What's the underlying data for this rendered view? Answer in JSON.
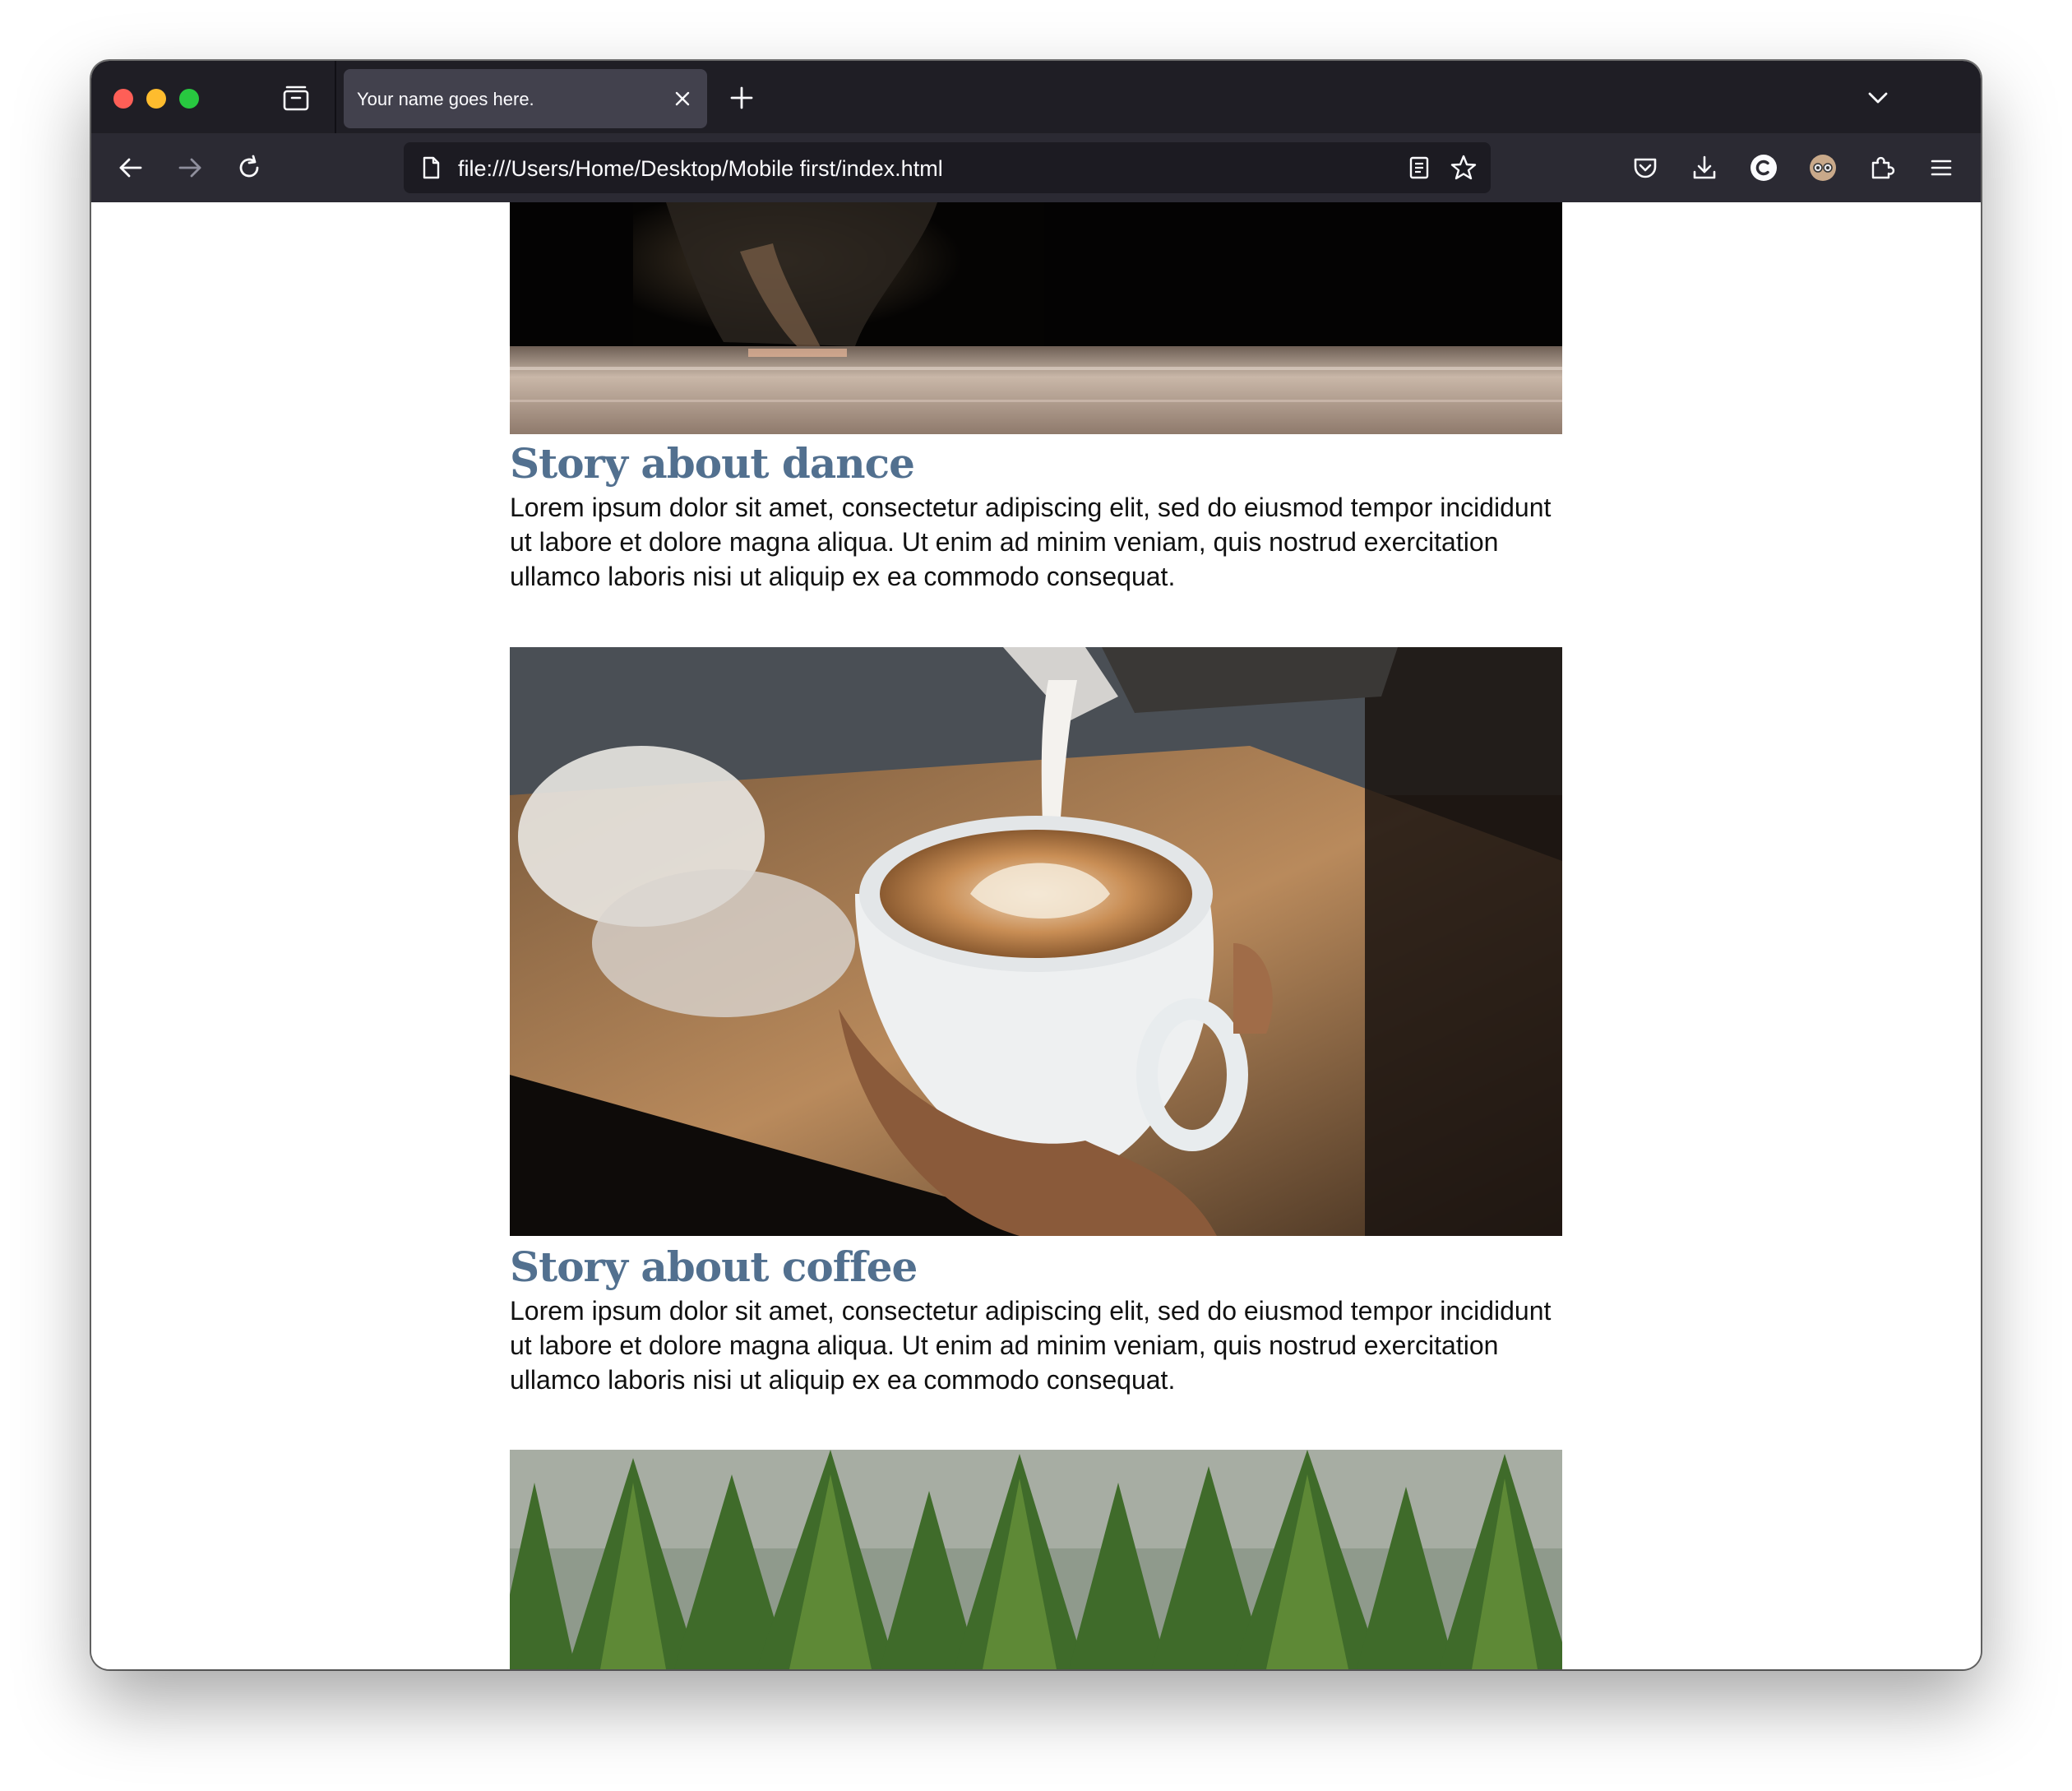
{
  "browser": {
    "tab_title": "Your name goes here.",
    "url": "file:///Users/Home/Desktop/Mobile first/index.html"
  },
  "toolbar_icons": [
    "back-arrow-icon",
    "forward-arrow-icon",
    "reload-icon",
    "document-icon",
    "reader-view-icon",
    "bookmark-star-icon",
    "pocket-icon",
    "download-icon",
    "profile-c-icon",
    "extension-avatar-icon",
    "extensions-puzzle-icon",
    "hamburger-menu-icon"
  ],
  "colors": {
    "heading": "#52708f",
    "body_text": "#111111",
    "tab_bar": "#1f1e25",
    "toolbar": "#2b2a33"
  },
  "stories": [
    {
      "title": "Story about dance",
      "body": "Lorem ipsum dolor sit amet, consectetur adipiscing elit, sed do eiusmod tempor incididunt ut labore et dolore magna aliqua. Ut enim ad minim veniam, quis nostrud exercitation ullamco laboris nisi ut aliquip ex ea commodo consequat.",
      "image": "dance-photo"
    },
    {
      "title": "Story about coffee",
      "body": "Lorem ipsum dolor sit amet, consectetur adipiscing elit, sed do eiusmod tempor incididunt ut labore et dolore magna aliqua. Ut enim ad minim veniam, quis nostrud exercitation ullamco laboris nisi ut aliquip ex ea commodo consequat.",
      "image": "coffee-latte-photo"
    },
    {
      "image": "pine-forest-photo"
    }
  ]
}
